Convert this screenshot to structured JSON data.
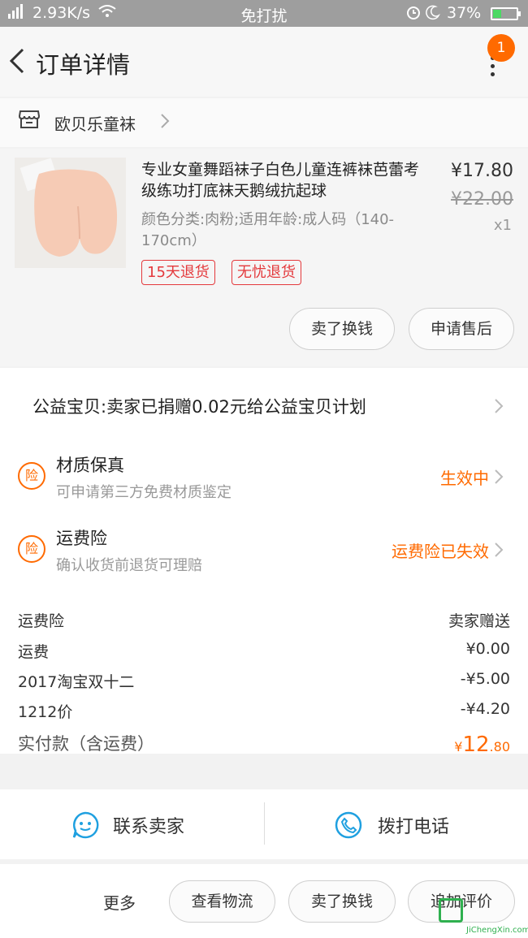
{
  "status_bar": {
    "signal": "ᵆʟʟ",
    "speed": "2.93K/s",
    "mode": "免打扰",
    "battery_text": "37%",
    "battery_level": 0.37
  },
  "header": {
    "title": "订单详情",
    "badge_count": "1"
  },
  "store": {
    "name": "欧贝乐童袜"
  },
  "product": {
    "name": "专业女童舞蹈袜子白色儿童连裤袜芭蕾考级练功打底袜天鹅绒抗起球",
    "spec": "颜色分类:肉粉;适用年龄:成人码（140-170cm）",
    "price": "¥17.80",
    "original_price": "¥22.00",
    "quantity": "x1",
    "tags": [
      "15天退货",
      "无忧退货"
    ],
    "actions": [
      "卖了换钱",
      "申请售后"
    ]
  },
  "charity": {
    "text": "公益宝贝:卖家已捐赠0.02元给公益宝贝计划"
  },
  "services": [
    {
      "icon_text": "险",
      "title": "材质保真",
      "desc": "可申请第三方免费材质鉴定",
      "status": "生效中"
    },
    {
      "icon_text": "险",
      "title": "运费险",
      "desc": "确认收货前退货可理赔",
      "status": "运费险已失效"
    }
  ],
  "fees": [
    {
      "label": "运费险",
      "value": "卖家赠送"
    },
    {
      "label": "运费",
      "value": "¥0.00"
    },
    {
      "label": "2017淘宝双十二",
      "value": "-¥5.00"
    },
    {
      "label": "1212价",
      "value": "-¥4.20"
    }
  ],
  "total": {
    "label": "实付款（含运费）",
    "currency": "¥",
    "integer": "12",
    "decimal": ".80"
  },
  "contact": {
    "seller_label": "联系卖家",
    "phone_label": "拨打电话"
  },
  "bottom_bar": {
    "more_label": "更多",
    "buttons": [
      "查看物流",
      "卖了换钱",
      "追加评价"
    ]
  },
  "watermark": {
    "text": "JiChengXin.com"
  },
  "colors": {
    "accent": "#ff6a00",
    "tag_red": "#e4393c",
    "contact_blue": "#1fa0e0"
  }
}
